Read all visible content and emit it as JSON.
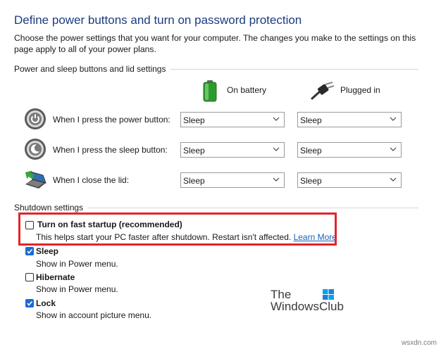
{
  "page": {
    "title": "Define power buttons and turn on password protection",
    "description": "Choose the power settings that you want for your computer. The changes you make to the settings on this page apply to all of your power plans."
  },
  "power_section": {
    "heading": "Power and sleep buttons and lid settings",
    "col_battery": "On battery",
    "col_plugged": "Plugged in",
    "rows": [
      {
        "label": "When I press the power button:",
        "battery": "Sleep",
        "plugged": "Sleep",
        "icon": "power-button-icon"
      },
      {
        "label": "When I press the sleep button:",
        "battery": "Sleep",
        "plugged": "Sleep",
        "icon": "sleep-button-icon"
      },
      {
        "label": "When I close the lid:",
        "battery": "Sleep",
        "plugged": "Sleep",
        "icon": "laptop-lid-icon"
      }
    ]
  },
  "shutdown_section": {
    "heading": "Shutdown settings",
    "items": [
      {
        "label": "Turn on fast startup (recommended)",
        "desc": "This helps start your PC faster after shutdown. Restart isn't affected.",
        "link": "Learn More",
        "checked": false
      },
      {
        "label": "Sleep",
        "desc": "Show in Power menu.",
        "checked": true
      },
      {
        "label": "Hibernate",
        "desc": "Show in Power menu.",
        "checked": false
      },
      {
        "label": "Lock",
        "desc": "Show in account picture menu.",
        "checked": true
      }
    ]
  },
  "watermark": {
    "line1": "The",
    "line2": "WindowsClub"
  },
  "site_mark": "wsxdn.com",
  "colors": {
    "title": "#1b3b82",
    "highlight": "#e2242a",
    "checkbox": "#1a6ad6",
    "link": "#1a5fbd"
  }
}
